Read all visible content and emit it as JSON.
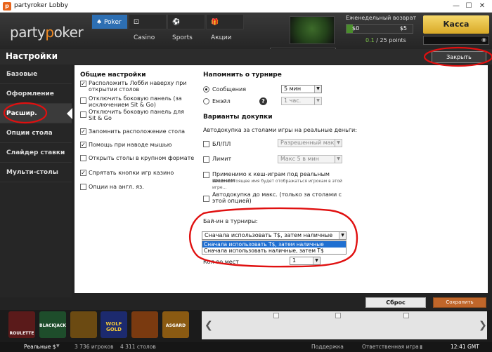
{
  "window": {
    "title": "partyroker Lobby",
    "min": "—",
    "max": "☐",
    "close": "✕"
  },
  "brand": {
    "left": "party",
    "right": "oker",
    "mid": "p"
  },
  "nav": {
    "poker": "Poker",
    "casino": "Casino",
    "sports": "Sports",
    "promo": "Акции"
  },
  "cashback": {
    "title": "Еженедельный возврат",
    "left": "$0",
    "right": "$5",
    "fill_fraction": 0.1,
    "points_value": "0.1",
    "points_rest": "/ 25 points"
  },
  "kassa": "Касса",
  "page": {
    "title": "Настройки",
    "close_button": "Закрыть настройки"
  },
  "sidebar": {
    "items": [
      {
        "label": "Базовые"
      },
      {
        "label": "Оформление"
      },
      {
        "label": "Расшир."
      },
      {
        "label": "Опции стола"
      },
      {
        "label": "Слайдер ставки"
      },
      {
        "label": "Мульти-столы"
      }
    ]
  },
  "general": {
    "title": "Общие настройки",
    "options": [
      {
        "label": "Расположить Лобби наверху при открытии столов",
        "checked": true
      },
      {
        "label": "Отключить боковую панель (за исключением Sit & Go)",
        "checked": false
      },
      {
        "label": "Отключить боковую панель для Sit & Go",
        "checked": false
      },
      {
        "label": "Запомнить расположение стола",
        "checked": true
      },
      {
        "label": "Помощь при наводе мышью",
        "checked": true
      },
      {
        "label": "Открыть столы в крупном формате",
        "checked": false
      },
      {
        "label": "Спрятать кнопки игр казино",
        "checked": true
      },
      {
        "label": "Опции на англ. яз.",
        "checked": false
      }
    ]
  },
  "remind": {
    "title": "Напомнить о турнире",
    "messages": "Сообщения",
    "messages_value": "5 мин",
    "email": "Емэйл",
    "email_value": "1 час."
  },
  "rebuy": {
    "title": "Варианты докупки",
    "subtitle": "Автодокупка за столами игры на реальные деньги:",
    "nl_label": "БЛ/ПЛ",
    "nl_value": "Разрешенный макс",
    "limit_label": "Лимит",
    "limit_value": "Макс 5 в мин",
    "realname_label": "Применимо к кеш-играм под реальным именем",
    "realname_note": "Ваше настоящее имя будет отображаться игрокам в этой игре...",
    "automax_label": "Автодокупка до макс. (только за столами с этой опцией)"
  },
  "buyin": {
    "title": "Бай-ин в турниры:",
    "selected": "Сначала использовать T$, затем наличные",
    "options": [
      "Сначала использовать T$, затем наличные",
      "Сначала использовать наличные, затем T$"
    ],
    "seats_label": "Кол-во мест",
    "seats_value": "1"
  },
  "buttons": {
    "reset": "Сброс",
    "save": "Сохранить изменения"
  },
  "games": [
    {
      "label": "ROULETTE",
      "color": "#5a1a1a"
    },
    {
      "label": "BLACKJACK",
      "color": "#1e4d2b"
    },
    {
      "label": "",
      "color": "#6b4a12"
    },
    {
      "label": "WOLF GOLD",
      "color": "#1c2a6e"
    },
    {
      "label": "",
      "color": "#7a3a10"
    },
    {
      "label": "ASGARD",
      "color": "#8a5a12"
    }
  ],
  "ad": {
    "prev": "❮",
    "next": "❯"
  },
  "status": {
    "mode": "Реальные $",
    "players": "3 736 игроков",
    "tables": "4 311 столов",
    "support": "Поддержка",
    "responsible": "Ответственная игра",
    "time": "12:41 GMT"
  }
}
